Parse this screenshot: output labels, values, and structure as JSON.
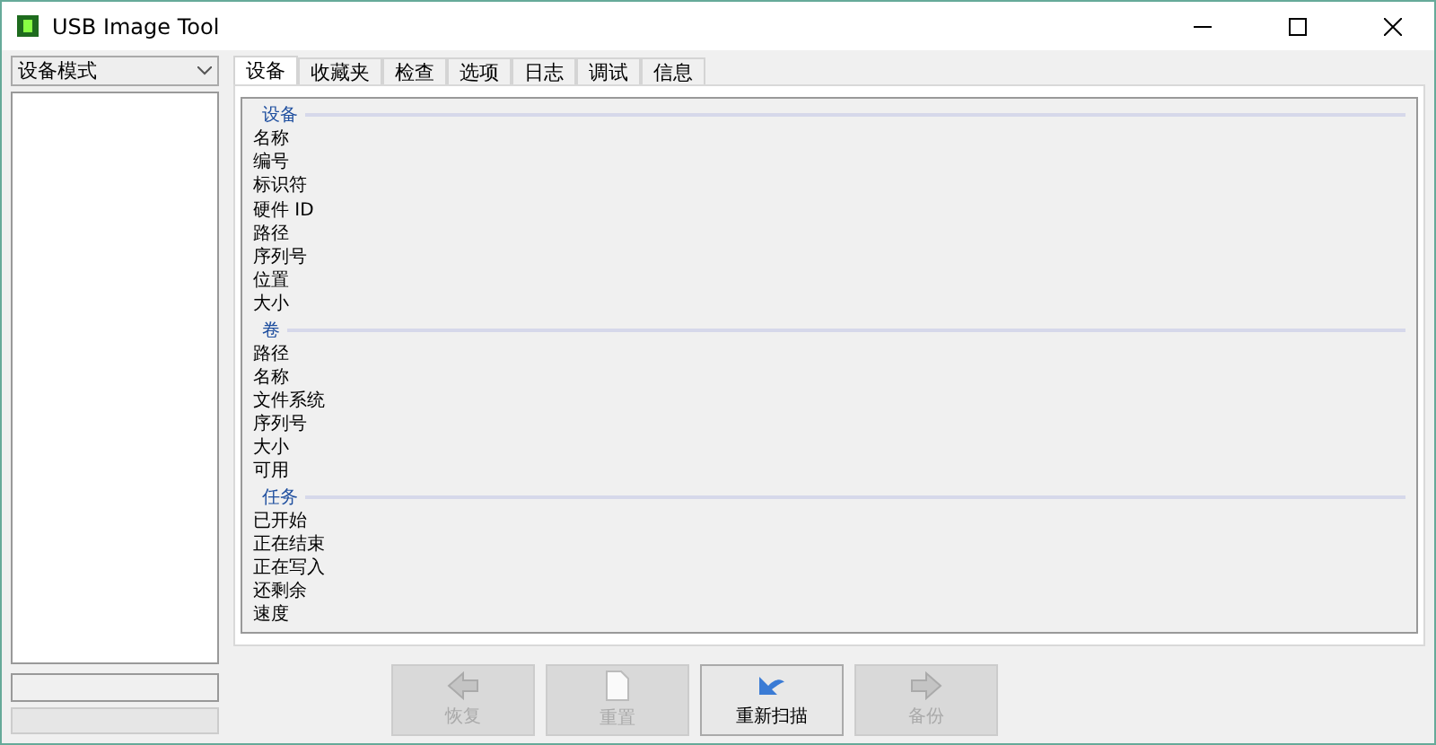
{
  "window": {
    "title": "USB Image Tool"
  },
  "sidebar": {
    "mode_dropdown": "设备模式",
    "progress": {
      "level": 0
    }
  },
  "tabs": [
    {
      "label": "设备",
      "selected": true
    },
    {
      "label": "收藏夹",
      "selected": false
    },
    {
      "label": "检查",
      "selected": false
    },
    {
      "label": "选项",
      "selected": false
    },
    {
      "label": "日志",
      "selected": false
    },
    {
      "label": "调试",
      "selected": false
    },
    {
      "label": "信息",
      "selected": false
    }
  ],
  "sections": [
    {
      "title": "设备",
      "fields": [
        "名称",
        "编号",
        "标识符",
        "硬件 ID",
        "路径",
        "序列号",
        "位置",
        "大小"
      ]
    },
    {
      "title": "卷",
      "fields": [
        "路径",
        "名称",
        "文件系统",
        "序列号",
        "大小",
        "可用"
      ]
    },
    {
      "title": "任务",
      "fields": [
        "已开始",
        "正在结束",
        "正在写入",
        "还剩余",
        "速度"
      ]
    }
  ],
  "buttons": [
    {
      "label": "恢复",
      "kind": "back",
      "disabled": true
    },
    {
      "label": "重置",
      "kind": "page",
      "disabled": true
    },
    {
      "label": "重新扫描",
      "kind": "rescan",
      "disabled": false
    },
    {
      "label": "备份",
      "kind": "forward",
      "disabled": true
    }
  ]
}
